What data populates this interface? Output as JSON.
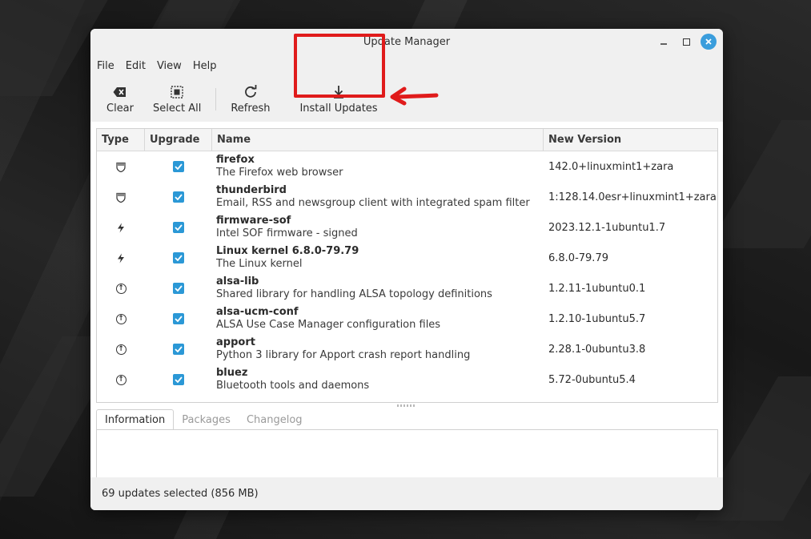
{
  "window": {
    "title": "Update Manager"
  },
  "menu": [
    "File",
    "Edit",
    "View",
    "Help"
  ],
  "toolbar": {
    "clear_label": "Clear",
    "select_all_label": "Select All",
    "refresh_label": "Refresh",
    "install_label": "Install Updates"
  },
  "table": {
    "headers": {
      "type": "Type",
      "upgrade": "Upgrade",
      "name": "Name",
      "version": "New Version"
    },
    "rows": [
      {
        "icon": "shield-icon",
        "checked": true,
        "name": "firefox",
        "desc": "The Firefox web browser",
        "version": "142.0+linuxmint1+zara"
      },
      {
        "icon": "shield-icon",
        "checked": true,
        "name": "thunderbird",
        "desc": "Email, RSS and newsgroup client with integrated spam filter",
        "version": "1:128.14.0esr+linuxmint1+zara"
      },
      {
        "icon": "lightning-icon",
        "checked": true,
        "name": "firmware-sof",
        "desc": "Intel SOF firmware - signed",
        "version": "2023.12.1-1ubuntu1.7"
      },
      {
        "icon": "lightning-icon",
        "checked": true,
        "name": "Linux kernel 6.8.0-79.79",
        "desc": "The Linux kernel",
        "version": "6.8.0-79.79"
      },
      {
        "icon": "arrow-up-circle-icon",
        "checked": true,
        "name": "alsa-lib",
        "desc": "Shared library for handling ALSA topology definitions",
        "version": "1.2.11-1ubuntu0.1"
      },
      {
        "icon": "arrow-up-circle-icon",
        "checked": true,
        "name": "alsa-ucm-conf",
        "desc": "ALSA Use Case Manager configuration files",
        "version": "1.2.10-1ubuntu5.7"
      },
      {
        "icon": "arrow-up-circle-icon",
        "checked": true,
        "name": "apport",
        "desc": "Python 3 library for Apport crash report handling",
        "version": "2.28.1-0ubuntu3.8"
      },
      {
        "icon": "arrow-up-circle-icon",
        "checked": true,
        "name": "bluez",
        "desc": "Bluetooth tools and daemons",
        "version": "5.72-0ubuntu5.4"
      }
    ]
  },
  "tabs": [
    "Information",
    "Packages",
    "Changelog"
  ],
  "status": "69 updates selected (856 MB)",
  "colors": {
    "accent": "#2b98d6",
    "highlight": "#e01b1b"
  }
}
